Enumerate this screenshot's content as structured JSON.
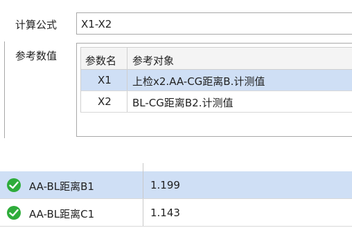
{
  "form": {
    "formula_label": "计算公式",
    "formula_value": "X1-X2",
    "params_label": "参考数值"
  },
  "params_table": {
    "headers": [
      "参数名",
      "参考对象"
    ],
    "rows": [
      {
        "name": "X1",
        "ref": "上检x2.AA-CG距离B.计测值"
      },
      {
        "name": "X2",
        "ref": "BL-CG距离B2.计测值"
      }
    ]
  },
  "results_table": {
    "rows": [
      {
        "name": "AA-BL距离B1",
        "value": "1.199",
        "status_icon": "check-circle-icon"
      },
      {
        "name": "AA-BL距离C1",
        "value": "1.143",
        "status_icon": "check-circle-icon"
      }
    ]
  },
  "colors": {
    "selection": "#cfdff5",
    "check_green": "#2eac3a"
  }
}
